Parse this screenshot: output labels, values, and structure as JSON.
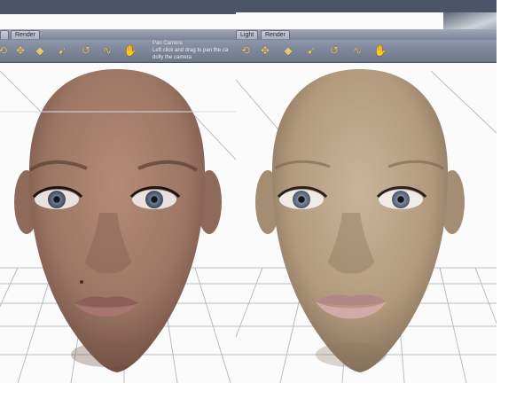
{
  "left_viewport": {
    "tabs": [
      "",
      "Render"
    ],
    "tooltip": {
      "title": "Pan Camera",
      "line1": "Left click and drag to pan the ca",
      "line2": "dolly the camera"
    },
    "tool_icons": [
      "rotate-icon",
      "move-icon",
      "scale-icon",
      "pointer-icon",
      "twist-icon",
      "swirl-icon",
      "hand-icon"
    ],
    "skin_tone": "#9c7664"
  },
  "right_viewport": {
    "tabs": [
      "Light",
      "Render"
    ],
    "tool_icons": [
      "rotate-icon",
      "move-icon",
      "scale-icon",
      "pointer-icon",
      "twist-icon",
      "swirl-icon",
      "hand-icon"
    ],
    "skin_tone": "#b39a7e"
  },
  "colors": {
    "toolbar": "#7c8598",
    "tool_icon": "#e7c77a",
    "grid_line": "#b8bcc4"
  }
}
